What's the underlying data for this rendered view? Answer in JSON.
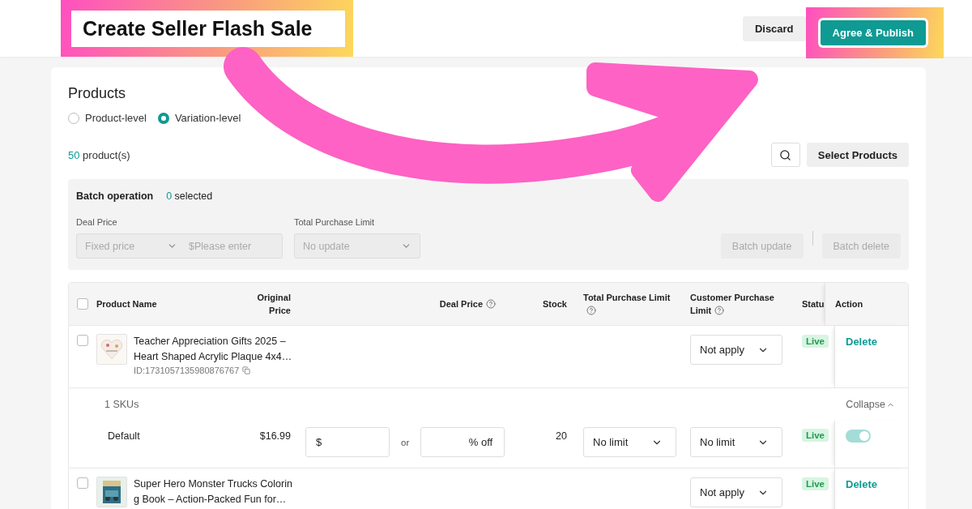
{
  "header": {
    "title": {
      "text": "Create Seller Flash Sale",
      "highlighted": true
    },
    "buttons": [
      {
        "label": "Discard",
        "kind": "secondary",
        "highlighted": false
      },
      {
        "label": "Agree & Publish",
        "kind": "primary",
        "highlighted": true
      }
    ]
  },
  "products": {
    "title": "Products",
    "level_options": [
      {
        "label": "Product-level",
        "selected": false
      },
      {
        "label": "Variation-level",
        "selected": true
      }
    ],
    "count": "50",
    "count_label": "product(s)",
    "select_button": "Select Products",
    "batch": {
      "title": "Batch operation",
      "selected_count": "0",
      "selected_label": "selected",
      "deal_price_label": "Deal Price",
      "deal_price_type": {
        "placeholder": "Fixed price"
      },
      "deal_price_value": {
        "placeholder": "$Please enter"
      },
      "limit_label": "Total Purchase Limit",
      "limit_select": {
        "placeholder": "No update"
      },
      "buttons": [
        {
          "label": "Batch update",
          "disabled": true
        },
        {
          "label": "Batch delete",
          "disabled": true
        }
      ]
    },
    "table": {
      "select_all": {
        "checked": false
      },
      "columns": [
        {
          "label": "Product Name",
          "help": false
        },
        {
          "label": "Original Price",
          "help": false
        },
        {
          "label": "Deal Price",
          "help": true
        },
        {
          "label": "Stock",
          "help": false
        },
        {
          "label": "Total Purchase Limit",
          "help": true
        },
        {
          "label": "Customer Purchase Limit",
          "help": true
        },
        {
          "label": "Statu",
          "help": false
        },
        {
          "label": "Action",
          "help": false
        }
      ],
      "rows": [
        {
          "checked": false,
          "name": "Teacher Appreciation Gifts 2025 – Heart Shaped Acrylic Plaque 4x4…",
          "id": "ID:1731057135980876767",
          "customer_limit": "Not apply",
          "status": "Live",
          "action": "Delete",
          "skus": {
            "count": "1 SKUs",
            "toggle": "Collapse",
            "expanded": true,
            "items": [
              {
                "name": "Default",
                "original_price": "$16.99",
                "deal_prefix": "$",
                "or": "or",
                "discount_suffix": "% off",
                "stock": "20",
                "total_limit": "No limit",
                "customer_limit": "No limit",
                "status": "Live",
                "on": true
              }
            ]
          }
        },
        {
          "checked": false,
          "name": "Super Hero Monster Trucks Coloring Book – Action-Packed Fun for…",
          "customer_limit": "Not apply",
          "status": "Live",
          "action": "Delete"
        }
      ]
    }
  }
}
